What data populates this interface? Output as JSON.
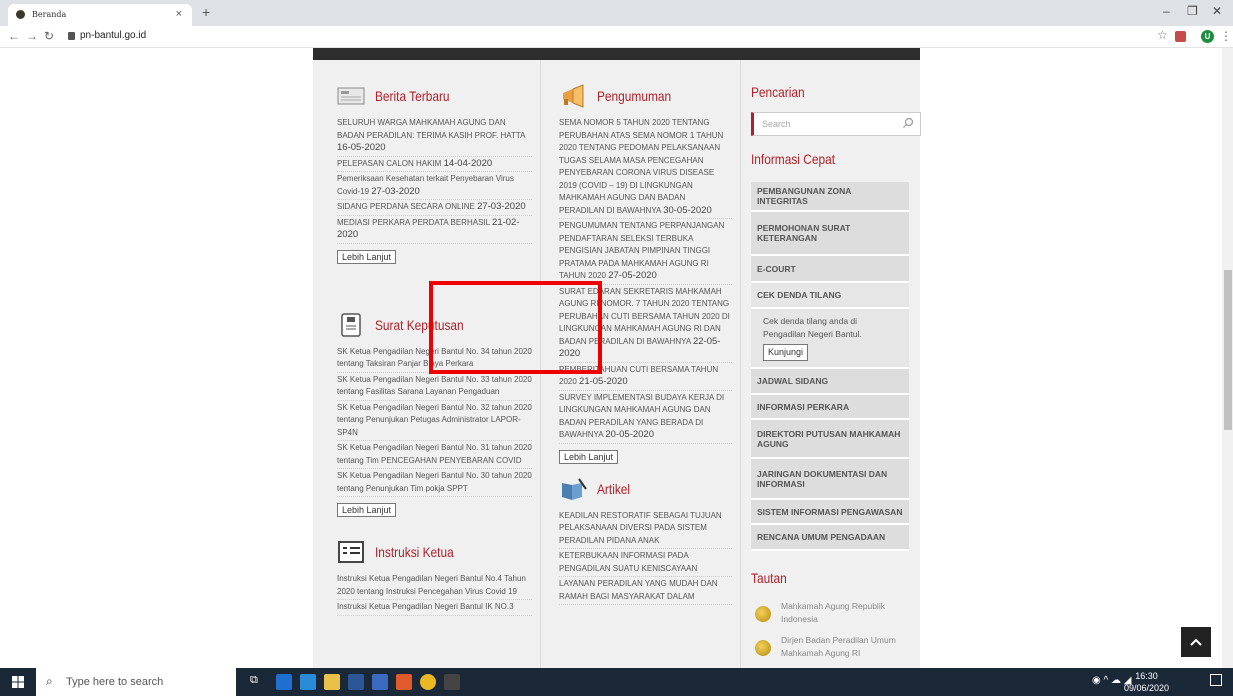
{
  "browser": {
    "tab_title": "Beranda",
    "tab_close": "×",
    "new_tab": "+",
    "url": "pn-bantul.go.id",
    "profile_initial": "U"
  },
  "berita": {
    "title": "Berita Terbaru",
    "items": [
      {
        "text": "SELURUH WARGA MAHKAMAH AGUNG DAN BADAN PERADILAN: TERIMA KASIH PROF. HATTA",
        "date": "16-05-2020"
      },
      {
        "text": "PELEPASAN CALON HAKIM",
        "date": "14-04-2020"
      },
      {
        "text": "Pemeriksaan Kesehatan terkait Penyebaran Virus Covid-19",
        "date": "27-03-2020"
      },
      {
        "text": "SIDANG PERDANA SECARA ONLINE",
        "date": "27-03-2020"
      },
      {
        "text": "MEDIASI PERKARA PERDATA BERHASIL",
        "date": "21-02-2020"
      }
    ],
    "more": "Lebih Lanjut"
  },
  "surat": {
    "title": "Surat Keputusan",
    "items": [
      "SK Ketua Pengadilan Negeri Bantul No. 34 tahun 2020 tentang Taksiran Panjar Biaya Perkara",
      "SK Ketua Pengadilan Negeri Bantul No. 33 tahun 2020 tentang Fasilitas Sarana Layanan Pengaduan",
      "SK Ketua Pengadilan Negeri Bantul No. 32 tahun 2020 tentang Penunjukan Petugas Administrator LAPOR-SP4N",
      "SK Ketua Pengadilan Negeri Bantul No. 31 tahun 2020 tentang Tim PENCEGAHAN PENYEBARAN COVID",
      "SK Ketua Pengadilan Negeri Bantul No. 30 tahun 2020 tentang Penunjukan Tim pokja SPPT"
    ],
    "more": "Lebih Lanjut"
  },
  "instruksi": {
    "title": "Instruksi Ketua",
    "items": [
      "Instruksi Ketua Pengadilan Negeri Bantul No.4 Tahun 2020 tentang Instruksi Pencegahan Virus Covid 19",
      "Instruksi Ketua Pengadilan Negeri Bantul IK NO.3"
    ]
  },
  "pengumuman": {
    "title": "Pengumuman",
    "items": [
      {
        "text": "SEMA NOMOR 5 TAHUN 2020 TENTANG PERUBAHAN ATAS SEMA NOMOR 1 TAHUN 2020 TENTANG PEDOMAN PELAKSANAAN TUGAS SELAMA MASA PENCEGAHAN PENYEBARAN CORONA VIRUS DISEASE 2019 (COVID – 19) DI LINGKUNGAN MAHKAMAH AGUNG DAN BADAN PERADILAN DI BAWAHNYA",
        "date": "30-05-2020"
      },
      {
        "text": "PENGUMUMAN TENTANG PERPANJANGAN PENDAFTARAN SELEKSI TERBUKA PENGISIAN JABATAN PIMPINAN TINGGI PRATAMA PADA MAHKAMAH AGUNG RI TAHUN 2020",
        "date": "27-05-2020"
      },
      {
        "text": "SURAT EDARAN SEKRETARIS MAHKAMAH AGUNG RI NOMOR. 7 TAHUN 2020 TENTANG PERUBAHAN CUTI BERSAMA TAHUN 2020 DI LINGKUNGAN MAHKAMAH AGUNG RI DAN BADAN PERADILAN DI BAWAHNYA",
        "date": "22-05-2020"
      },
      {
        "text": "PEMBERITAHUAN CUTI BERSAMA TAHUN 2020",
        "date": "21-05-2020"
      },
      {
        "text": "SURVEY IMPLEMENTASI BUDAYA KERJA DI LINGKUNGAN MAHKAMAH AGUNG DAN BADAN PERADILAN YANG BERADA DI BAWAHNYA",
        "date": "20-05-2020"
      }
    ],
    "more": "Lebih Lanjut"
  },
  "artikel": {
    "title": "Artikel",
    "items": [
      "KEADILAN RESTORATIF SEBAGAI TUJUAN PELAKSANAAN DIVERSI PADA SISTEM PERADILAN PIDANA ANAK",
      "KETERBUKAAN INFORMASI PADA PENGADILAN SUATU KENISCAYAAN",
      "LAYANAN PERADILAN YANG MUDAH DAN RAMAH BAGI MASYARAKAT DALAM"
    ]
  },
  "sidebar": {
    "pencarian_title": "Pencarian",
    "search_placeholder": "Search",
    "info_title": "Informasi Cepat",
    "info_items": [
      "PEMBANGUNAN ZONA INTEGRITAS",
      "PERMOHONAN SURAT KETERANGAN",
      "E-COURT",
      "CEK DENDA TILANG",
      "JADWAL SIDANG",
      "INFORMASI PERKARA",
      "DIREKTORI PUTUSAN MAHKAMAH AGUNG",
      "JARINGAN DOKUMENTASI DAN INFORMASI",
      "SISTEM INFORMASI PENGAWASAN",
      "RENCANA UMUM PENGADAAN"
    ],
    "tilang_text": "Cek denda tilang anda di Pengadilan Negeri Bantul.",
    "tilang_button": "Kunjungi",
    "tautan_title": "Tautan",
    "tautan_items": [
      "Mahkamah Agung Republik Indonesia",
      "Dirjen Badan Peradilan Umum Mahkamah Agung RI"
    ]
  },
  "taskbar": {
    "search_placeholder": "Type here to search",
    "time": "16:30",
    "date": "09/06/2020"
  },
  "colors": {
    "accent": "#b3202a",
    "highlight_box": "#ee0000"
  }
}
